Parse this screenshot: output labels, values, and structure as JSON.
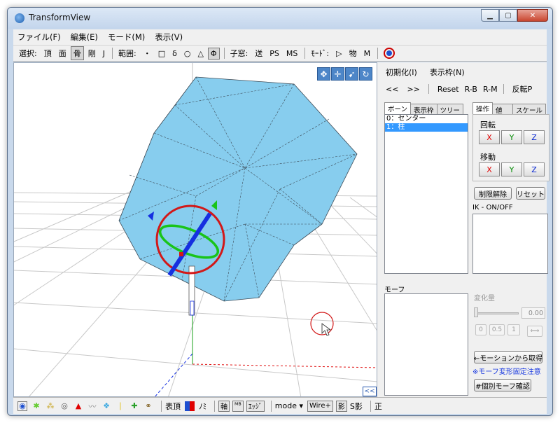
{
  "window": {
    "title": "TransformView",
    "min": "▁",
    "max": "▢",
    "close": "✕"
  },
  "menu": [
    "ファイル(F)",
    "編集(E)",
    "モード(M)",
    "表示(V)"
  ],
  "toolbar": {
    "select_label": "選択:",
    "sel_vertex": "頂",
    "sel_face": "面",
    "sel_bone": "骨",
    "sel_rigid": "剛",
    "sel_joint": "J",
    "range_label": "範囲:",
    "range_items": [
      "・",
      "□",
      "δ",
      "○",
      "△",
      "Φ"
    ],
    "child_label": "子窓:",
    "child_items": [
      "送",
      "PS",
      "MS"
    ],
    "mode_label": "ﾓｰﾄﾞ:",
    "mode_items": [
      "▷",
      "物",
      "M"
    ]
  },
  "viewport": {
    "tools": [
      "✥",
      "✛",
      "➹",
      "↻"
    ],
    "collapse": "<<"
  },
  "right_panel": {
    "top_row": [
      "初期化(I)",
      "表示枠(N)"
    ],
    "nav_row": [
      "<<",
      ">>",
      "Reset",
      "R-B",
      "R-M",
      "反転P"
    ],
    "list_tabs": [
      "ボーン",
      "表示枠",
      "ツリー"
    ],
    "bones": [
      "0：センター",
      "1：柱"
    ],
    "op_tabs": [
      "操作",
      "値",
      "スケール"
    ],
    "rotate_label": "回転",
    "move_label": "移動",
    "axes": [
      "X",
      "Y",
      "Z"
    ],
    "limit_release": "制限解除",
    "reset": "リセット",
    "ik_label": "IK - ON/OFF",
    "morph_label": "モーフ",
    "change_label": "変化量",
    "change_value": "0.00",
    "preset_btns": [
      "0",
      "0.5",
      "1",
      "⟺"
    ],
    "get_from_motion": "←モーションから取得",
    "morph_note": "※モーフ変形固定注意",
    "individual_morph": "#個別モーフ確認"
  },
  "bottombar": {
    "icons": [
      "◉",
      "✱",
      "⁂",
      "◎",
      "▲",
      "〰",
      "❖",
      "❘",
      "✚",
      "⚭"
    ],
    "show_vertex": "表頂",
    "only": "ﾉﾐ",
    "axis": "軸",
    "mb": "ᴹᴮ",
    "edge": "ｴｯｼﾞ",
    "mode": "mode ▾",
    "wire": "Wire+",
    "shadow": "影",
    "s_shadow": "S影",
    "correct": "正"
  },
  "colors": {
    "cube_fill": "#87cdee",
    "ring_red": "#d21818",
    "ring_green": "#19c419",
    "ring_blue": "#1530e0",
    "grid": "#c8c8c8"
  }
}
